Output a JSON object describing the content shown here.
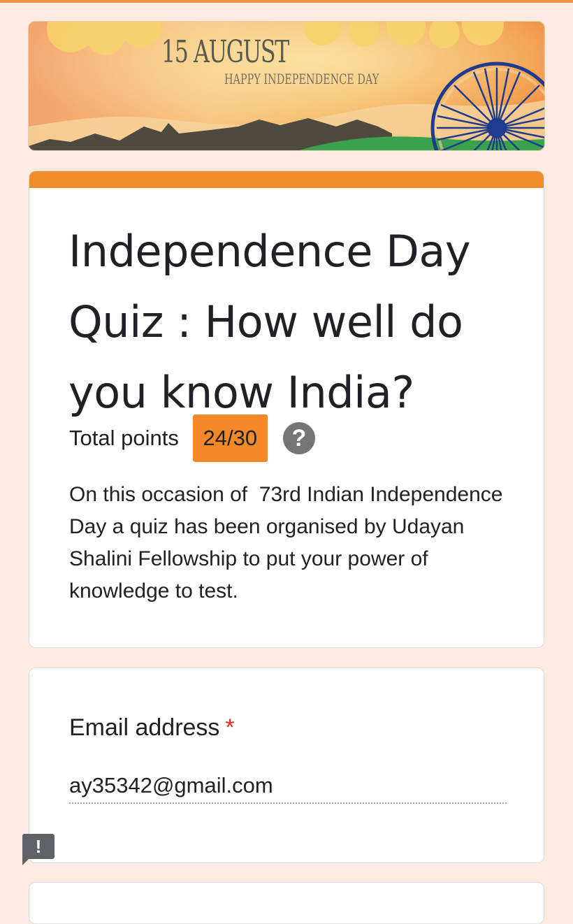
{
  "banner": {
    "title": "15 AUGUST",
    "subtitle": "HAPPY INDEPENDENCE DAY"
  },
  "form": {
    "title": "Independence Day Quiz : How well do you know India?",
    "points_label": "Total points",
    "points_value": "24/30",
    "help_icon": "?",
    "description": "On this occasion of  73rd Indian Independence Day a quiz has been organised by Udayan Shalini Fellowship to put your power of knowledge to test."
  },
  "email": {
    "label": "Email address",
    "required_marker": "*",
    "value": "ay35342@gmail.com"
  },
  "feedback": {
    "icon": "!"
  },
  "colors": {
    "accent": "#f28c2a",
    "points_badge": "#f5892a",
    "background": "#fdeae0",
    "required": "#d93025"
  }
}
